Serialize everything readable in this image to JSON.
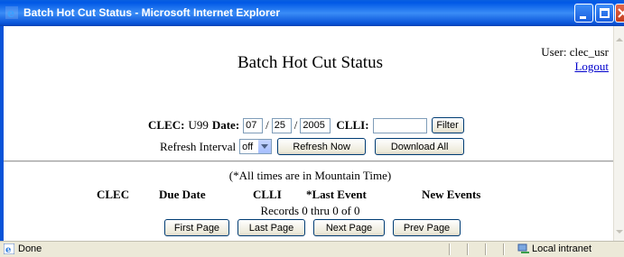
{
  "window": {
    "title": "Batch Hot Cut Status - Microsoft Internet Explorer"
  },
  "header": {
    "page_title": "Batch Hot Cut Status",
    "user_text": "User: clec_usr",
    "logout_label": "Logout"
  },
  "filter": {
    "clec_label": "CLEC:",
    "clec_value": "U99",
    "date_label": "Date:",
    "month": "07",
    "day": "25",
    "year": "2005",
    "sep": "/",
    "clli_label": "CLLI:",
    "clli_value": "",
    "filter_button": "Filter",
    "refresh_label": "Refresh Interval",
    "refresh_value": "off",
    "refresh_now_button": "Refresh Now",
    "download_all_button": "Download All"
  },
  "table": {
    "note": "(*All times are in Mountain Time)",
    "columns": [
      "CLEC",
      "Due Date",
      "CLLI",
      "*Last Event",
      "New Events"
    ],
    "records_text": "Records 0 thru 0 of 0"
  },
  "pager": {
    "first": "First Page",
    "last": "Last Page",
    "next": "Next Page",
    "prev": "Prev Page"
  },
  "statusbar": {
    "status": "Done",
    "zone": "Local intranet"
  },
  "colors": {
    "titlebar": "#0a5fe0",
    "link": "#0000cc",
    "button_face": "#ece9d8"
  }
}
